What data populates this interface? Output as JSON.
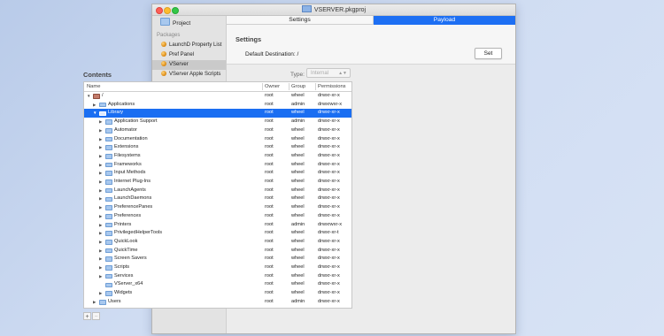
{
  "window": {
    "title": "VSERVER.pkgproj"
  },
  "sidebar": {
    "project_label": "Project",
    "section_label": "Packages",
    "items": [
      {
        "label": "LaunchD Property List"
      },
      {
        "label": "Pref Panel"
      },
      {
        "label": "VServer",
        "selected": true
      },
      {
        "label": "VServer Apple Scripts"
      }
    ]
  },
  "tabs": [
    {
      "label": "Settings"
    },
    {
      "label": "Payload",
      "selected": true
    }
  ],
  "settings": {
    "title": "Settings",
    "destination_label": "Default Destination:  /",
    "set_button": "Set"
  },
  "contents": {
    "title": "Contents",
    "type_label": "Type:",
    "type_value": "Internal",
    "columns": [
      "Name",
      "Owner",
      "Group",
      "Permissions"
    ],
    "rows": [
      {
        "name": "/",
        "owner": "root",
        "group": "wheel",
        "perm": "drwxr-xr-x",
        "depth": 0,
        "expanded": true,
        "icon": "drive-icon"
      },
      {
        "name": "Applications",
        "owner": "root",
        "group": "admin",
        "perm": "drwxrwxr-x",
        "depth": 1,
        "expanded": false,
        "icon": "folder-icon"
      },
      {
        "name": "Library",
        "owner": "root",
        "group": "wheel",
        "perm": "drwxr-xr-x",
        "depth": 1,
        "expanded": true,
        "selected": true,
        "icon": "folder-icon"
      },
      {
        "name": "Application Support",
        "owner": "root",
        "group": "admin",
        "perm": "drwxr-xr-x",
        "depth": 2,
        "expanded": false,
        "icon": "folder-icon"
      },
      {
        "name": "Automator",
        "owner": "root",
        "group": "wheel",
        "perm": "drwxr-xr-x",
        "depth": 2,
        "expanded": false,
        "icon": "folder-icon"
      },
      {
        "name": "Documentation",
        "owner": "root",
        "group": "wheel",
        "perm": "drwxr-xr-x",
        "depth": 2,
        "expanded": false,
        "icon": "folder-icon"
      },
      {
        "name": "Extensions",
        "owner": "root",
        "group": "wheel",
        "perm": "drwxr-xr-x",
        "depth": 2,
        "expanded": false,
        "icon": "folder-icon"
      },
      {
        "name": "Filesystems",
        "owner": "root",
        "group": "wheel",
        "perm": "drwxr-xr-x",
        "depth": 2,
        "expanded": false,
        "icon": "folder-icon"
      },
      {
        "name": "Frameworks",
        "owner": "root",
        "group": "wheel",
        "perm": "drwxr-xr-x",
        "depth": 2,
        "expanded": false,
        "icon": "folder-icon"
      },
      {
        "name": "Input Methods",
        "owner": "root",
        "group": "wheel",
        "perm": "drwxr-xr-x",
        "depth": 2,
        "expanded": false,
        "icon": "folder-icon"
      },
      {
        "name": "Internet Plug-Ins",
        "owner": "root",
        "group": "wheel",
        "perm": "drwxr-xr-x",
        "depth": 2,
        "expanded": false,
        "icon": "folder-icon"
      },
      {
        "name": "LaunchAgents",
        "owner": "root",
        "group": "wheel",
        "perm": "drwxr-xr-x",
        "depth": 2,
        "expanded": false,
        "icon": "folder-icon"
      },
      {
        "name": "LaunchDaemons",
        "owner": "root",
        "group": "wheel",
        "perm": "drwxr-xr-x",
        "depth": 2,
        "expanded": false,
        "icon": "folder-icon"
      },
      {
        "name": "PreferencePanes",
        "owner": "root",
        "group": "wheel",
        "perm": "drwxr-xr-x",
        "depth": 2,
        "expanded": false,
        "icon": "folder-icon"
      },
      {
        "name": "Preferences",
        "owner": "root",
        "group": "wheel",
        "perm": "drwxr-xr-x",
        "depth": 2,
        "expanded": false,
        "icon": "folder-icon"
      },
      {
        "name": "Printers",
        "owner": "root",
        "group": "admin",
        "perm": "drwxrwxr-x",
        "depth": 2,
        "expanded": false,
        "icon": "folder-icon"
      },
      {
        "name": "PrivilegedHelperTools",
        "owner": "root",
        "group": "wheel",
        "perm": "drwxr-xr-t",
        "depth": 2,
        "expanded": false,
        "icon": "folder-icon"
      },
      {
        "name": "QuickLook",
        "owner": "root",
        "group": "wheel",
        "perm": "drwxr-xr-x",
        "depth": 2,
        "expanded": false,
        "icon": "folder-icon"
      },
      {
        "name": "QuickTime",
        "owner": "root",
        "group": "wheel",
        "perm": "drwxr-xr-x",
        "depth": 2,
        "expanded": false,
        "icon": "folder-icon"
      },
      {
        "name": "Screen Savers",
        "owner": "root",
        "group": "wheel",
        "perm": "drwxr-xr-x",
        "depth": 2,
        "expanded": false,
        "icon": "folder-icon"
      },
      {
        "name": "Scripts",
        "owner": "root",
        "group": "wheel",
        "perm": "drwxr-xr-x",
        "depth": 2,
        "expanded": false,
        "icon": "folder-icon"
      },
      {
        "name": "Services",
        "owner": "root",
        "group": "wheel",
        "perm": "drwxr-xr-x",
        "depth": 2,
        "expanded": false,
        "icon": "folder-icon"
      },
      {
        "name": "VServer_x64",
        "owner": "root",
        "group": "wheel",
        "perm": "drwxr-xr-x",
        "depth": 2,
        "leaf": true,
        "icon": "folder-icon"
      },
      {
        "name": "Widgets",
        "owner": "root",
        "group": "wheel",
        "perm": "drwxr-xr-x",
        "depth": 2,
        "expanded": false,
        "icon": "folder-icon"
      },
      {
        "name": "Users",
        "owner": "root",
        "group": "admin",
        "perm": "drwxr-xr-x",
        "depth": 1,
        "expanded": false,
        "icon": "folder-icon"
      }
    ]
  },
  "bottom_buttons": {
    "add": "+",
    "remove": "−"
  },
  "colors": {
    "accent": "#1a6ef2",
    "tab_selected": "#1d6ff3",
    "folder": "#a8c8ee"
  }
}
